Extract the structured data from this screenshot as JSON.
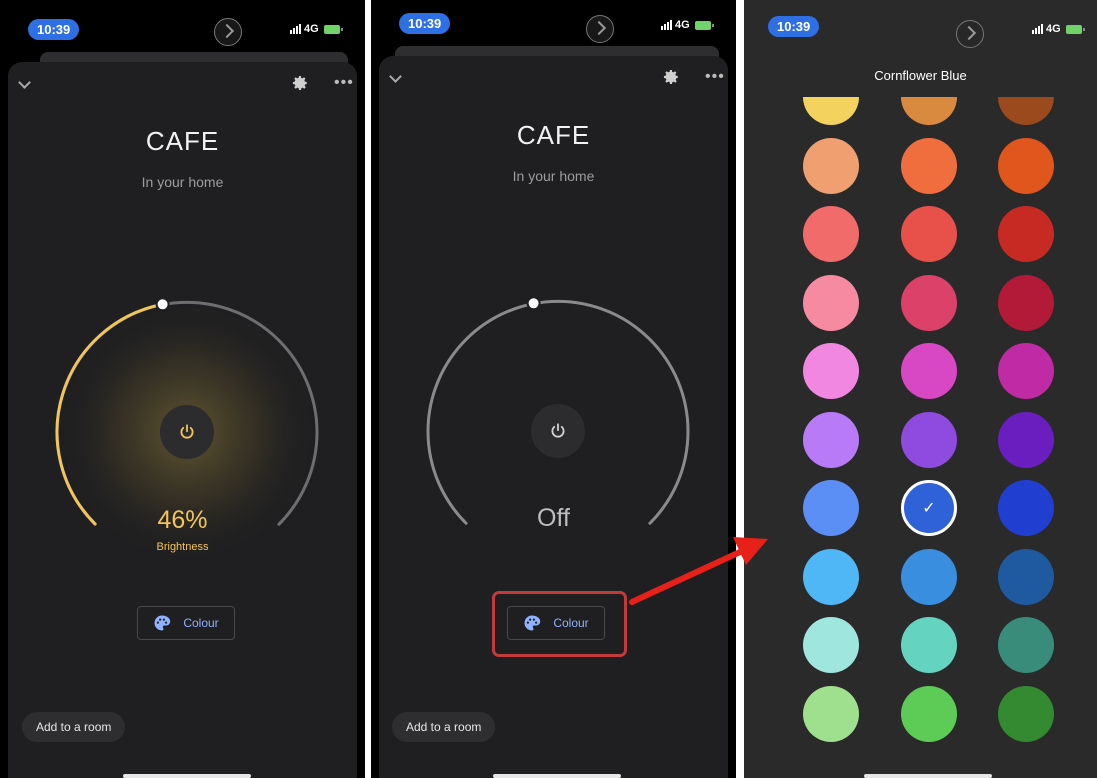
{
  "status": {
    "time": "10:39",
    "network": "4G"
  },
  "screens": [
    {
      "device_name": "CAFE",
      "location": "In your home",
      "value": "46%",
      "value_label": "Brightness",
      "brightness_fraction": 0.46,
      "state": "on",
      "colour_label": "Colour",
      "room_label": "Add to a room"
    },
    {
      "device_name": "CAFE",
      "location": "In your home",
      "value": "Off",
      "state": "off",
      "colour_label": "Colour",
      "room_label": "Add to a room"
    }
  ],
  "picker": {
    "title": "Cornflower Blue",
    "selected_index": 19,
    "swatches": [
      "#f3d25e",
      "#d98a3f",
      "#9a4a1c",
      "#f0a070",
      "#f06e3e",
      "#e0561d",
      "#f26b6b",
      "#e8504a",
      "#c72a22",
      "#f68aa0",
      "#dc416a",
      "#b31a37",
      "#f287e2",
      "#d848c4",
      "#c02aa4",
      "#b87af6",
      "#8f4be0",
      "#6a1ec0",
      "#5b8ff5",
      "#2f62d9",
      "#203fd0",
      "#4fb7f5",
      "#3a8ee0",
      "#1f5aa0",
      "#9ee6de",
      "#64d4c0",
      "#3a8c7a",
      "#9fe08e",
      "#5ccc56",
      "#338a30"
    ]
  },
  "colors": {
    "accent_warm": "#f2c45a",
    "accent_blue": "#8fb2ff",
    "highlight_red": "#c23a3a",
    "arrow_red": "#e8201a"
  },
  "icons": [
    "chevron-down-icon",
    "gear-icon",
    "more-icon",
    "power-icon",
    "palette-icon",
    "check-icon",
    "signal-icon",
    "battery-icon"
  ]
}
